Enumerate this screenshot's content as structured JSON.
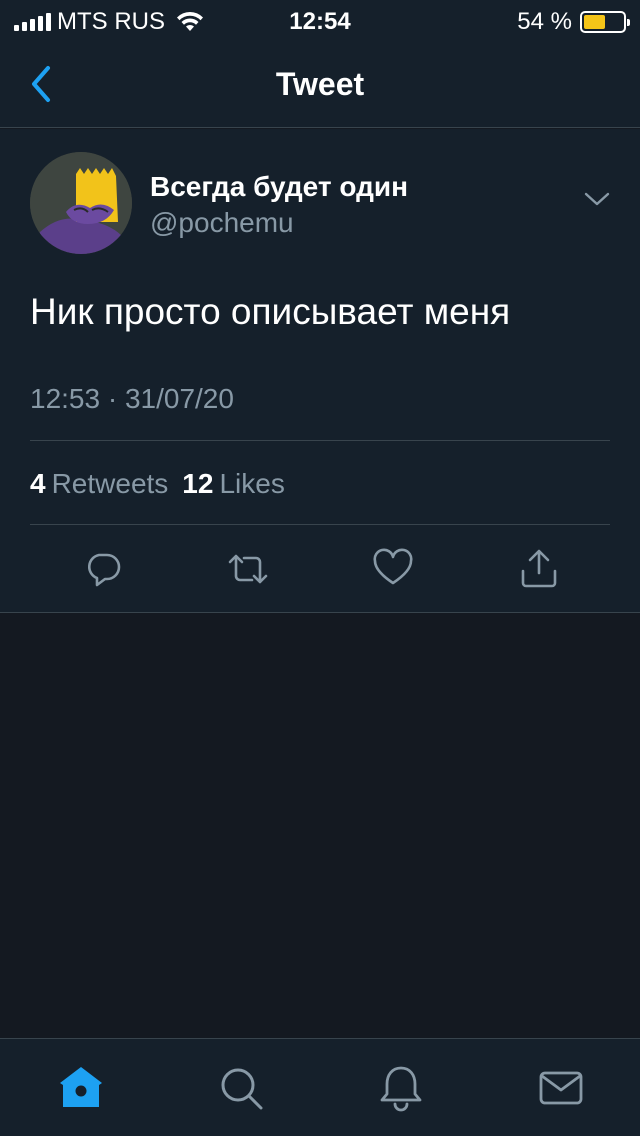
{
  "status_bar": {
    "carrier": "MTS RUS",
    "time": "12:54",
    "battery_percent": "54 %",
    "battery_level": 0.54,
    "battery_color": "#f5c518"
  },
  "nav": {
    "title": "Tweet",
    "back_icon": "chevron-left-icon"
  },
  "tweet": {
    "display_name": "Всегда будет один",
    "handle": "@pochemu",
    "text": "Ник просто описывает меня",
    "timestamp": "12:53 · 31/07/20",
    "retweets_count": "4",
    "retweets_label": "Retweets",
    "likes_count": "12",
    "likes_label": "Likes",
    "actions": [
      "reply-icon",
      "retweet-icon",
      "like-icon",
      "share-icon"
    ]
  },
  "tab_bar": {
    "tabs": [
      "home-icon",
      "search-icon",
      "notifications-icon",
      "messages-icon"
    ],
    "active": "home-icon"
  },
  "colors": {
    "accent": "#1da1f2",
    "background": "#15202b",
    "secondary_text": "#8899a6"
  }
}
